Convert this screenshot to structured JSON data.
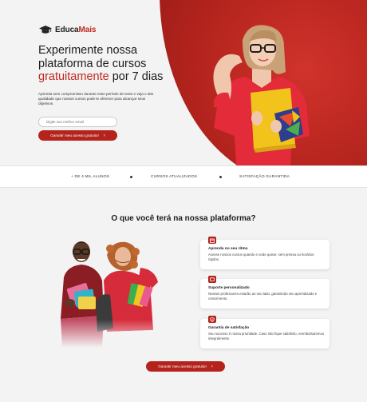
{
  "brand": {
    "name_part1": "Educa",
    "name_part2": "Mais"
  },
  "hero": {
    "title_line1": "Experimente nossa",
    "title_line2": "plataforma de cursos",
    "title_accent": "gratuitamente",
    "title_tail": " por 7 dias",
    "description": "Aprenda sem compromisso durante esse período de teste e veja o alto qualidade que nossos cursos pode te oferecer para alcançar seus objetivos.",
    "email_placeholder": "Digite seu melhor email",
    "cta_label": "Garantir meu acesso gratuito!",
    "cta_chevron": "›"
  },
  "strip": {
    "items": [
      "+ DE 4 MIL ALUNOS",
      "CURSOS ATUALIZADOS",
      "SATISFAÇÃO GARANTIDA"
    ]
  },
  "benefits": {
    "title": "O que você terá na nossa plataforma?",
    "cards": [
      {
        "title": "Aprenda no seu ritmo",
        "text": "Acesse nossos cursos quando e onde quiser, sem pressa ou horários rígidos."
      },
      {
        "title": "Suporte personalizado",
        "text": "Nossos professores estarão ao seu lado, garantindo seu aprendizado e crescimento."
      },
      {
        "title": "Garantia de satisfação",
        "text": "Seu sucesso é nossa prioridade. Caso não fique satisfeito, reembolsaremos integralmente."
      }
    ],
    "cta_label": "Garantir meu acesso gratuito!",
    "cta_chevron": "›"
  },
  "colors": {
    "accent": "#b4241d",
    "background": "#f3f3f3"
  }
}
